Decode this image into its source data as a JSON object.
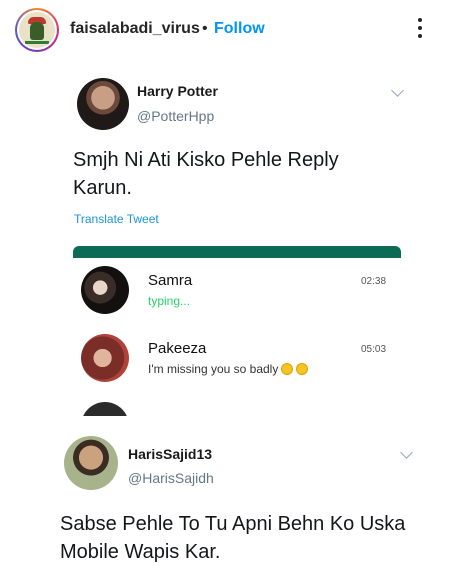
{
  "instagram": {
    "username": "faisalabadi_virus",
    "separator": "•",
    "follow_label": "Follow",
    "more_icon": "more-vertical-icon"
  },
  "tweet": {
    "name": "Harry Potter",
    "handle": "@PotterHpp",
    "text": "Smjh Ni Ati Kisko Pehle Reply Karun.",
    "translate_label": "Translate Tweet",
    "whatsapp": {
      "accent_color": "#0b6b57",
      "chats": [
        {
          "name": "Samra",
          "preview": "typing...",
          "time": "02:38"
        },
        {
          "name": "Pakeeza",
          "preview": "I'm missing you so badly",
          "time": "05:03"
        }
      ]
    }
  },
  "reply": {
    "name": "HarisSajid13",
    "handle": "@HarisSajidh",
    "text": "Sabse Pehle To Tu Apni Behn Ko Uska Mobile Wapis Kar."
  }
}
